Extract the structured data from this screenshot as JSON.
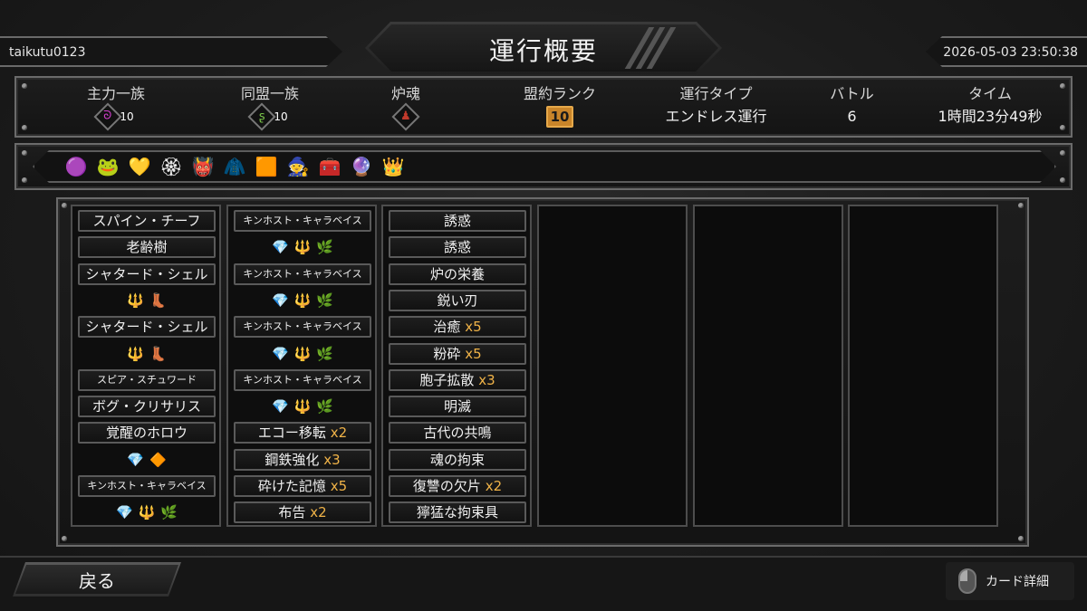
{
  "header": {
    "username": "taikutu0123",
    "title": "運行概要",
    "datetime": "2026-05-03 23:50:38"
  },
  "stats": {
    "main_clan": {
      "label": "主力一族",
      "level": "10",
      "icon": "spiral-purple-icon"
    },
    "allied_clan": {
      "label": "同盟一族",
      "level": "10",
      "icon": "green-serpent-icon"
    },
    "pyre_heart": {
      "label": "炉魂",
      "icon": "red-figure-icon"
    },
    "covenant_rank": {
      "label": "盟約ランク",
      "value": "10"
    },
    "run_type": {
      "label": "運行タイプ",
      "value": "エンドレス運行"
    },
    "battle": {
      "label": "バトル",
      "value": "6"
    },
    "time": {
      "label": "タイム",
      "value": "1時間23分49秒"
    }
  },
  "relics": [
    {
      "icon": "purple-crystal-icon",
      "glyph": "🟣"
    },
    {
      "icon": "green-beast-icon",
      "glyph": "🐸"
    },
    {
      "icon": "yellow-gem-icon",
      "glyph": "💛"
    },
    {
      "icon": "flower-burst-icon",
      "glyph": "🏵"
    },
    {
      "icon": "fire-demon-icon",
      "glyph": "👹"
    },
    {
      "icon": "red-cloak-icon",
      "glyph": "🧥"
    },
    {
      "icon": "ember-card-icon",
      "glyph": "🟧"
    },
    {
      "icon": "blue-spirit-icon",
      "glyph": "🧙"
    },
    {
      "icon": "treasure-chest-icon",
      "glyph": "🧰"
    },
    {
      "icon": "crystal-cluster-icon",
      "glyph": "🔮"
    },
    {
      "icon": "white-crown-icon",
      "glyph": "👑"
    }
  ],
  "columns": {
    "col1": [
      {
        "type": "card",
        "name": "スパイン・チーフ"
      },
      {
        "type": "card",
        "name": "老齢樹"
      },
      {
        "type": "card",
        "name": "シャタード・シェル"
      },
      {
        "type": "gems",
        "gems": [
          "🔱",
          "👢"
        ]
      },
      {
        "type": "card",
        "name": "シャタード・シェル"
      },
      {
        "type": "gems",
        "gems": [
          "🔱",
          "👢"
        ]
      },
      {
        "type": "card",
        "name": "スピア・スチュワード",
        "small": true
      },
      {
        "type": "card",
        "name": "ボグ・クリサリス"
      },
      {
        "type": "card",
        "name": "覚醒のホロウ"
      },
      {
        "type": "gems",
        "gems": [
          "💎",
          "🔶"
        ]
      },
      {
        "type": "card",
        "name": "キンホスト・キャラベイス",
        "small": true
      },
      {
        "type": "gems",
        "gems": [
          "💎",
          "🔱",
          "🌿"
        ]
      }
    ],
    "col2": [
      {
        "type": "card",
        "name": "キンホスト・キャラベイス",
        "small": true
      },
      {
        "type": "gems",
        "gems": [
          "💎",
          "🔱",
          "🌿"
        ]
      },
      {
        "type": "card",
        "name": "キンホスト・キャラベイス",
        "small": true
      },
      {
        "type": "gems",
        "gems": [
          "💎",
          "🔱",
          "🌿"
        ]
      },
      {
        "type": "card",
        "name": "キンホスト・キャラベイス",
        "small": true
      },
      {
        "type": "gems",
        "gems": [
          "💎",
          "🔱",
          "🌿"
        ]
      },
      {
        "type": "card",
        "name": "キンホスト・キャラベイス",
        "small": true
      },
      {
        "type": "gems",
        "gems": [
          "💎",
          "🔱",
          "🌿"
        ]
      },
      {
        "type": "card",
        "name": "エコー移転",
        "mult": "x2"
      },
      {
        "type": "card",
        "name": "鋼鉄強化",
        "mult": "x3"
      },
      {
        "type": "card",
        "name": "砕けた記憶",
        "mult": "x5"
      },
      {
        "type": "card",
        "name": "布告",
        "mult": "x2"
      }
    ],
    "col3": [
      {
        "type": "card",
        "name": "誘惑"
      },
      {
        "type": "card",
        "name": "誘惑"
      },
      {
        "type": "card",
        "name": "炉の栄養"
      },
      {
        "type": "card",
        "name": "鋭い刃"
      },
      {
        "type": "card",
        "name": "治癒",
        "mult": "x5"
      },
      {
        "type": "card",
        "name": "粉砕",
        "mult": "x5"
      },
      {
        "type": "card",
        "name": "胞子拡散",
        "mult": "x3"
      },
      {
        "type": "card",
        "name": "明滅"
      },
      {
        "type": "card",
        "name": "古代の共鳴"
      },
      {
        "type": "card",
        "name": "魂の拘束"
      },
      {
        "type": "card",
        "name": "復讐の欠片",
        "mult": "x2"
      },
      {
        "type": "card",
        "name": "獰猛な拘束具"
      }
    ]
  },
  "footer": {
    "back_label": "戻る",
    "card_detail_label": "カード詳細"
  },
  "colors": {
    "accent_gold": "#f0b348",
    "rank_badge": "#c9852a",
    "clan_purple": "#d63fd0",
    "clan_green": "#7bc74a"
  }
}
